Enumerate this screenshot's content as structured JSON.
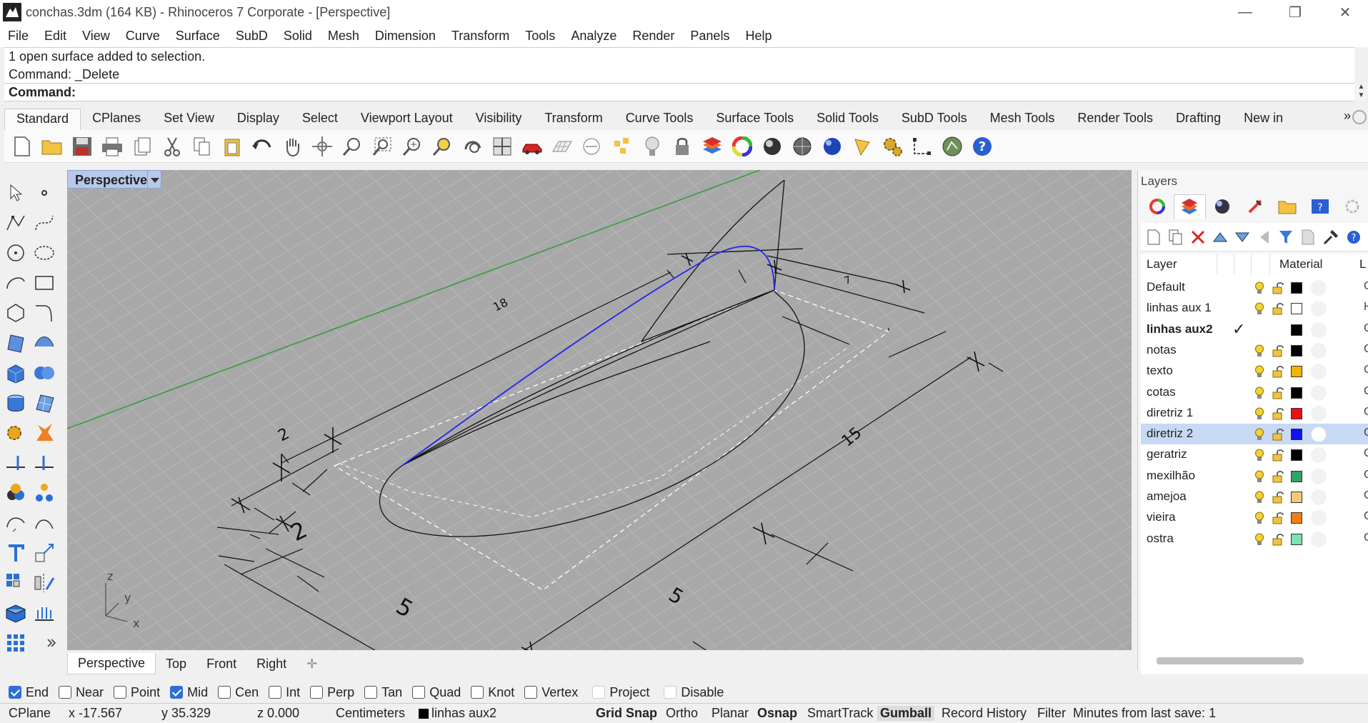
{
  "window": {
    "title": "conchas.3dm (164 KB) - Rhinoceros 7 Corporate - [Perspective]",
    "minimize": "—",
    "restore": "❐",
    "close": "✕"
  },
  "menu": [
    "File",
    "Edit",
    "View",
    "Curve",
    "Surface",
    "SubD",
    "Solid",
    "Mesh",
    "Dimension",
    "Transform",
    "Tools",
    "Analyze",
    "Render",
    "Panels",
    "Help"
  ],
  "command": {
    "history": [
      "1 open surface added to selection.",
      "Command: _Delete"
    ],
    "prompt": "Command:"
  },
  "toolbar_tabs": [
    "Standard",
    "CPlanes",
    "Set View",
    "Display",
    "Select",
    "Viewport Layout",
    "Visibility",
    "Transform",
    "Curve Tools",
    "Surface Tools",
    "Solid Tools",
    "SubD Tools",
    "Mesh Tools",
    "Render Tools",
    "Drafting",
    "New in"
  ],
  "toolbar_more": "»",
  "viewport": {
    "label": "Perspective",
    "dim_labels": [
      "18",
      "2",
      "2",
      "5",
      "5",
      "15",
      "7"
    ],
    "axes": {
      "x": "x",
      "y": "y",
      "z": "z"
    }
  },
  "viewport_tabs": [
    "Perspective",
    "Top",
    "Front",
    "Right"
  ],
  "viewport_tab_add": "✛",
  "layers": {
    "title": "Layers",
    "header": {
      "layer": "Layer",
      "material": "Material",
      "linetype": "L"
    },
    "rows": [
      {
        "name": "Default",
        "color": "#000000",
        "trail": "C",
        "current": false,
        "selected": false
      },
      {
        "name": "linhas aux 1",
        "color": "#ffffff",
        "trail": "H",
        "current": false,
        "selected": false
      },
      {
        "name": "linhas aux2",
        "color": "#000000",
        "trail": "C",
        "current": true,
        "selected": false
      },
      {
        "name": "notas",
        "color": "#000000",
        "trail": "C",
        "current": false,
        "selected": false
      },
      {
        "name": "texto",
        "color": "#f0b400",
        "trail": "C",
        "current": false,
        "selected": false
      },
      {
        "name": "cotas",
        "color": "#000000",
        "trail": "C",
        "current": false,
        "selected": false
      },
      {
        "name": "diretriz 1",
        "color": "#e81010",
        "trail": "C",
        "current": false,
        "selected": false
      },
      {
        "name": "diretriz 2",
        "color": "#1010f0",
        "trail": "C",
        "current": false,
        "selected": true
      },
      {
        "name": "geratriz",
        "color": "#000000",
        "trail": "C",
        "current": false,
        "selected": false
      },
      {
        "name": "mexilhão",
        "color": "#2ea36a",
        "trail": "C",
        "current": false,
        "selected": false
      },
      {
        "name": "amejoa",
        "color": "#f5c97a",
        "trail": "C",
        "current": false,
        "selected": false
      },
      {
        "name": "vieira",
        "color": "#f07f10",
        "trail": "C",
        "current": false,
        "selected": false
      },
      {
        "name": "ostra",
        "color": "#7fe0b0",
        "trail": "C",
        "current": false,
        "selected": false
      }
    ],
    "current_mark": "✓"
  },
  "osnaps": [
    {
      "label": "End",
      "on": true
    },
    {
      "label": "Near",
      "on": false
    },
    {
      "label": "Point",
      "on": false
    },
    {
      "label": "Mid",
      "on": true
    },
    {
      "label": "Cen",
      "on": false
    },
    {
      "label": "Int",
      "on": false
    },
    {
      "label": "Perp",
      "on": false
    },
    {
      "label": "Tan",
      "on": false
    },
    {
      "label": "Quad",
      "on": false
    },
    {
      "label": "Knot",
      "on": false
    },
    {
      "label": "Vertex",
      "on": false
    },
    {
      "label": "Project",
      "on": false,
      "dim": true
    },
    {
      "label": "Disable",
      "on": false,
      "dim": true
    }
  ],
  "status": {
    "cplane": "CPlane",
    "x": "x -17.567",
    "y": "y 35.329",
    "z": "z 0.000",
    "units": "Centimeters",
    "layer": "linhas aux2",
    "grid_snap": "Grid Snap",
    "ortho": "Ortho",
    "planar": "Planar",
    "osnap": "Osnap",
    "smarttrack": "SmartTrack",
    "gumball": "Gumball",
    "record_history": "Record History",
    "filter": "Filter",
    "autosave": "Minutes from last save: 1"
  }
}
